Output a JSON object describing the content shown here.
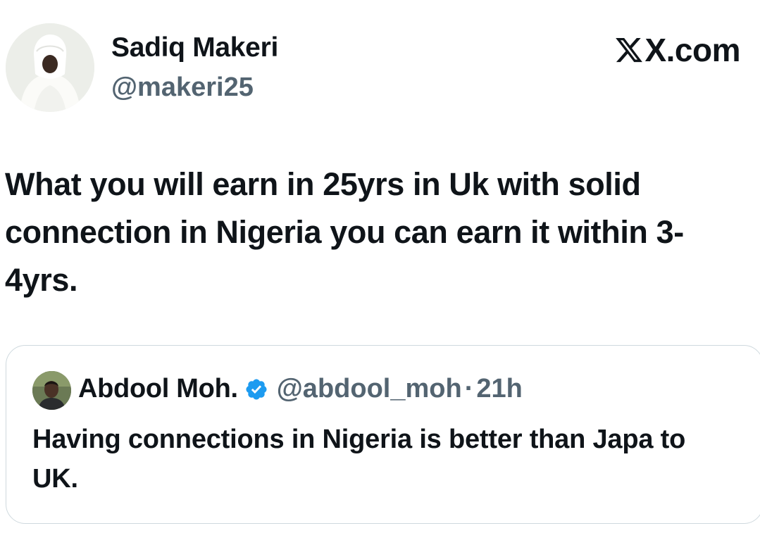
{
  "post": {
    "author": {
      "display_name": "Sadiq Makeri",
      "handle": "@makeri25"
    },
    "brand": {
      "text": "X.com",
      "logo_icon": "x-logo-icon"
    },
    "text": "What you will earn in 25yrs in Uk with solid connection in Nigeria you can earn it within 3-4yrs."
  },
  "quoted_post": {
    "author": {
      "display_name": "Abdool Moh.",
      "verified": true,
      "handle": "@abdool_moh",
      "separator": "·",
      "time": "21h"
    },
    "text": "Having connections in Nigeria is better than Japa to UK."
  },
  "colors": {
    "text_primary": "#0f1419",
    "text_secondary": "#536471",
    "verified_blue": "#1d9bf0",
    "card_border": "#cfd9de"
  }
}
